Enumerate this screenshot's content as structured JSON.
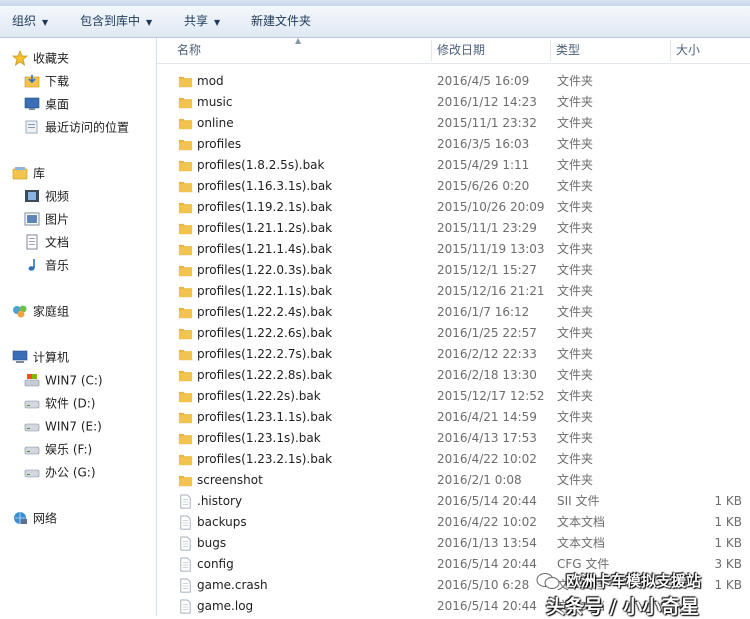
{
  "toolbar": {
    "organize": "组织",
    "include_in_library": "包含到库中",
    "share": "共享",
    "new_folder": "新建文件夹"
  },
  "nav": {
    "favorites": "收藏夹",
    "downloads": "下载",
    "desktop": "桌面",
    "recent": "最近访问的位置",
    "libraries": "库",
    "videos": "视频",
    "pictures": "图片",
    "documents": "文档",
    "music": "音乐",
    "homegroup": "家庭组",
    "computer": "计算机",
    "drives": [
      "WIN7 (C:)",
      "软件 (D:)",
      "WIN7 (E:)",
      "娱乐 (F:)",
      "办公 (G:)"
    ],
    "network": "网络"
  },
  "columns": {
    "name": "名称",
    "date": "修改日期",
    "type": "类型",
    "size": "大小"
  },
  "files": [
    {
      "name": "mod",
      "date": "2016/4/5 16:09",
      "type": "文件夹",
      "size": "",
      "kind": "folder"
    },
    {
      "name": "music",
      "date": "2016/1/12 14:23",
      "type": "文件夹",
      "size": "",
      "kind": "folder"
    },
    {
      "name": "online",
      "date": "2015/11/1 23:32",
      "type": "文件夹",
      "size": "",
      "kind": "folder"
    },
    {
      "name": "profiles",
      "date": "2016/3/5 16:03",
      "type": "文件夹",
      "size": "",
      "kind": "folder"
    },
    {
      "name": "profiles(1.8.2.5s).bak",
      "date": "2015/4/29 1:11",
      "type": "文件夹",
      "size": "",
      "kind": "folder"
    },
    {
      "name": "profiles(1.16.3.1s).bak",
      "date": "2015/6/26 0:20",
      "type": "文件夹",
      "size": "",
      "kind": "folder"
    },
    {
      "name": "profiles(1.19.2.1s).bak",
      "date": "2015/10/26 20:09",
      "type": "文件夹",
      "size": "",
      "kind": "folder"
    },
    {
      "name": "profiles(1.21.1.2s).bak",
      "date": "2015/11/1 23:29",
      "type": "文件夹",
      "size": "",
      "kind": "folder"
    },
    {
      "name": "profiles(1.21.1.4s).bak",
      "date": "2015/11/19 13:03",
      "type": "文件夹",
      "size": "",
      "kind": "folder"
    },
    {
      "name": "profiles(1.22.0.3s).bak",
      "date": "2015/12/1 15:27",
      "type": "文件夹",
      "size": "",
      "kind": "folder"
    },
    {
      "name": "profiles(1.22.1.1s).bak",
      "date": "2015/12/16 21:21",
      "type": "文件夹",
      "size": "",
      "kind": "folder"
    },
    {
      "name": "profiles(1.22.2.4s).bak",
      "date": "2016/1/7 16:12",
      "type": "文件夹",
      "size": "",
      "kind": "folder"
    },
    {
      "name": "profiles(1.22.2.6s).bak",
      "date": "2016/1/25 22:57",
      "type": "文件夹",
      "size": "",
      "kind": "folder"
    },
    {
      "name": "profiles(1.22.2.7s).bak",
      "date": "2016/2/12 22:33",
      "type": "文件夹",
      "size": "",
      "kind": "folder"
    },
    {
      "name": "profiles(1.22.2.8s).bak",
      "date": "2016/2/18 13:30",
      "type": "文件夹",
      "size": "",
      "kind": "folder"
    },
    {
      "name": "profiles(1.22.2s).bak",
      "date": "2015/12/17 12:52",
      "type": "文件夹",
      "size": "",
      "kind": "folder"
    },
    {
      "name": "profiles(1.23.1.1s).bak",
      "date": "2016/4/21 14:59",
      "type": "文件夹",
      "size": "",
      "kind": "folder"
    },
    {
      "name": "profiles(1.23.1s).bak",
      "date": "2016/4/13 17:53",
      "type": "文件夹",
      "size": "",
      "kind": "folder"
    },
    {
      "name": "profiles(1.23.2.1s).bak",
      "date": "2016/4/22 10:02",
      "type": "文件夹",
      "size": "",
      "kind": "folder"
    },
    {
      "name": "screenshot",
      "date": "2016/2/1 0:08",
      "type": "文件夹",
      "size": "",
      "kind": "folder"
    },
    {
      "name": ".history",
      "date": "2016/5/14 20:44",
      "type": "SII 文件",
      "size": "1 KB",
      "kind": "file"
    },
    {
      "name": "backups",
      "date": "2016/4/22 10:02",
      "type": "文本文档",
      "size": "1 KB",
      "kind": "file"
    },
    {
      "name": "bugs",
      "date": "2016/1/13 13:54",
      "type": "文本文档",
      "size": "1 KB",
      "kind": "file"
    },
    {
      "name": "config",
      "date": "2016/5/14 20:44",
      "type": "CFG 文件",
      "size": "3 KB",
      "kind": "file"
    },
    {
      "name": "game.crash",
      "date": "2016/5/10 6:28",
      "type": "文本文档",
      "size": "1 KB",
      "kind": "file"
    },
    {
      "name": "game.log",
      "date": "2016/5/14 20:44",
      "type": "文本文档",
      "size": "",
      "kind": "file"
    }
  ],
  "watermark": {
    "line1": "欧洲卡车模拟支援站",
    "line2": "头条号 / 小小奇星"
  },
  "colors": {
    "folder": "#f2c44e",
    "toolbar_text": "#1e395b",
    "secondary_text": "#6d6d6d"
  }
}
